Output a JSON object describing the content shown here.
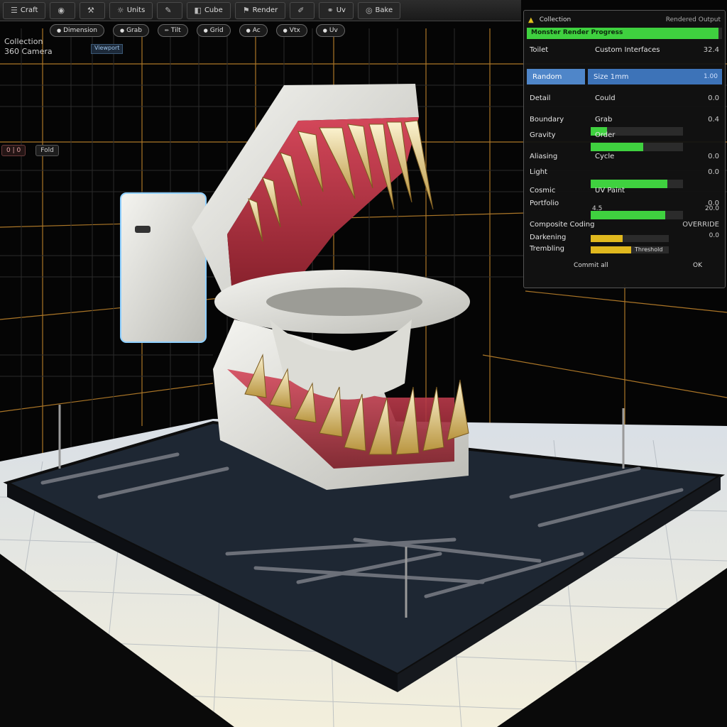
{
  "toolbar": {
    "items": [
      {
        "label": "Craft",
        "icon": "menu-icon"
      },
      {
        "label": "",
        "icon": "camera-icon"
      },
      {
        "label": "",
        "icon": "wrench-icon"
      },
      {
        "label": "Units",
        "icon": "sun-icon"
      },
      {
        "label": "",
        "icon": "brush-icon"
      },
      {
        "label": "Cube",
        "icon": "cube-icon"
      },
      {
        "label": "Render",
        "icon": "flag-icon"
      },
      {
        "label": "",
        "icon": "pen-icon"
      },
      {
        "label": "Uv",
        "icon": "link-icon"
      },
      {
        "label": "Bake",
        "icon": "eye-icon"
      }
    ]
  },
  "pills": [
    {
      "label": "Dimension",
      "icon": "circle-icon"
    },
    {
      "label": "Grab",
      "icon": "circle-icon"
    },
    {
      "label": "Tilt",
      "icon": "pencil-icon"
    },
    {
      "label": "Grid",
      "icon": "circle-icon"
    },
    {
      "label": "Ac",
      "icon": "circle-icon"
    },
    {
      "label": "Vtx",
      "icon": "circle-icon"
    },
    {
      "label": "Uv",
      "icon": "circle-icon"
    }
  ],
  "outliner": {
    "title_line1": "Collection",
    "title_line2": "360 Camera",
    "tag": "Viewport"
  },
  "frames": {
    "a": "0 | 0",
    "b": "Fold"
  },
  "panel": {
    "header_title": "Collection",
    "header_detail": "Rendered Output",
    "progress_label": "Monster Render Progress",
    "progress_value": 0.98,
    "row1": {
      "key": "Toilet",
      "value": "Custom Interfaces",
      "num": "32.4"
    },
    "active": {
      "tab": "Random",
      "field": "Size 1mm",
      "num": "1.00"
    },
    "rows": [
      {
        "key": "Detail",
        "value": "Could",
        "num": "0.0",
        "bar": 0.0
      },
      {
        "key": "Boundary",
        "value": "Grab",
        "num": "0.4",
        "bar": 0.18
      },
      {
        "key": "Gravity",
        "value": "Order",
        "num": "",
        "bar": 0.57
      },
      {
        "key": "Aliasing",
        "value": "Cycle",
        "num": "0.0",
        "bar": 0.0
      },
      {
        "key": "Light",
        "value": "",
        "num": "0.0",
        "bar": 0.83
      },
      {
        "key": "Cosmic",
        "value": "UV Paint",
        "num": "",
        "bar": 0.0
      },
      {
        "key": "Portfolio",
        "value": "",
        "num": "0.0",
        "bar": 0.81
      }
    ],
    "sub1": "4.5",
    "sub1_num": "20.0",
    "section": {
      "title": "Composite Coding",
      "right": "OVERRIDE",
      "num": "0.0"
    },
    "yrows": [
      {
        "key": "Darkening",
        "bar": 0.41
      },
      {
        "key": "Trembling",
        "bar": 0.52,
        "label": "Threshold"
      }
    ],
    "footer_left": "Commit all",
    "footer_right": "OK"
  }
}
